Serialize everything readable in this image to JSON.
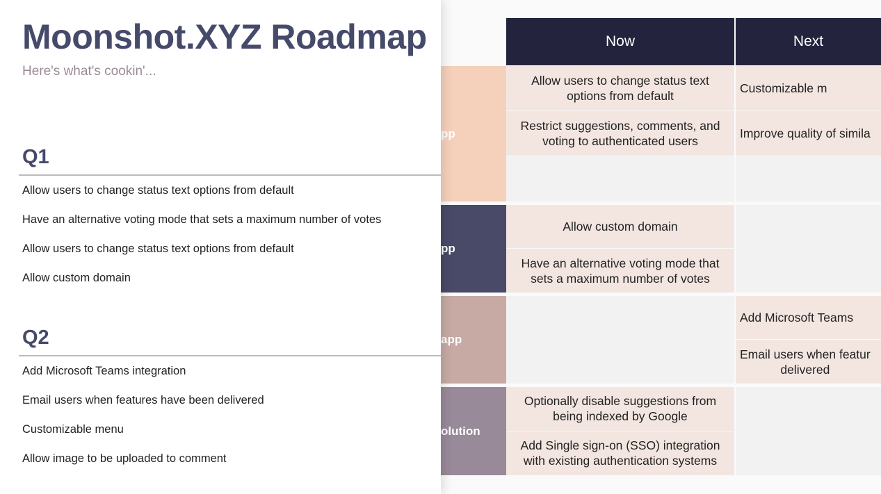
{
  "header": {
    "title": "Moonshot.XYZ Roadmap",
    "subtitle": "Here's what's cookin'..."
  },
  "quarters": [
    {
      "label": "Q1",
      "items": [
        "Allow users to change status text options from default",
        "Have an alternative voting mode that sets a maximum number of votes",
        "Allow users to change status text options from default",
        "Allow custom domain"
      ]
    },
    {
      "label": "Q2",
      "items": [
        "Add Microsoft Teams integration",
        "Email users when features have been delivered",
        "Customizable menu",
        "Allow image to be uploaded to comment"
      ]
    }
  ],
  "board": {
    "columns": [
      "Now",
      "Next"
    ],
    "rows": [
      {
        "label": "pp",
        "color": "#f5d1bb",
        "now": [
          "Allow users to change status text\noptions from default",
          "Restrict suggestions, comments, and\nvoting to authenticated users",
          ""
        ],
        "next": [
          "Customizable m",
          "Improve quality of simila",
          ""
        ]
      },
      {
        "label": "pp",
        "color": "#484a67",
        "now": [
          "Allow custom domain",
          "Have an alternative voting mode that\nsets a maximum number of votes"
        ],
        "next": []
      },
      {
        "label": "app",
        "color": "#c7aaa4",
        "now": [],
        "next": [
          "Add Microsoft Teams",
          "Email users when featur\ndelivered"
        ]
      },
      {
        "label": "olution",
        "color": "#988a99",
        "now": [
          "Optionally disable suggestions from\nbeing indexed by Google",
          "Add Single sign-on (SSO) integration\nwith existing authentication systems"
        ],
        "next": []
      }
    ]
  }
}
